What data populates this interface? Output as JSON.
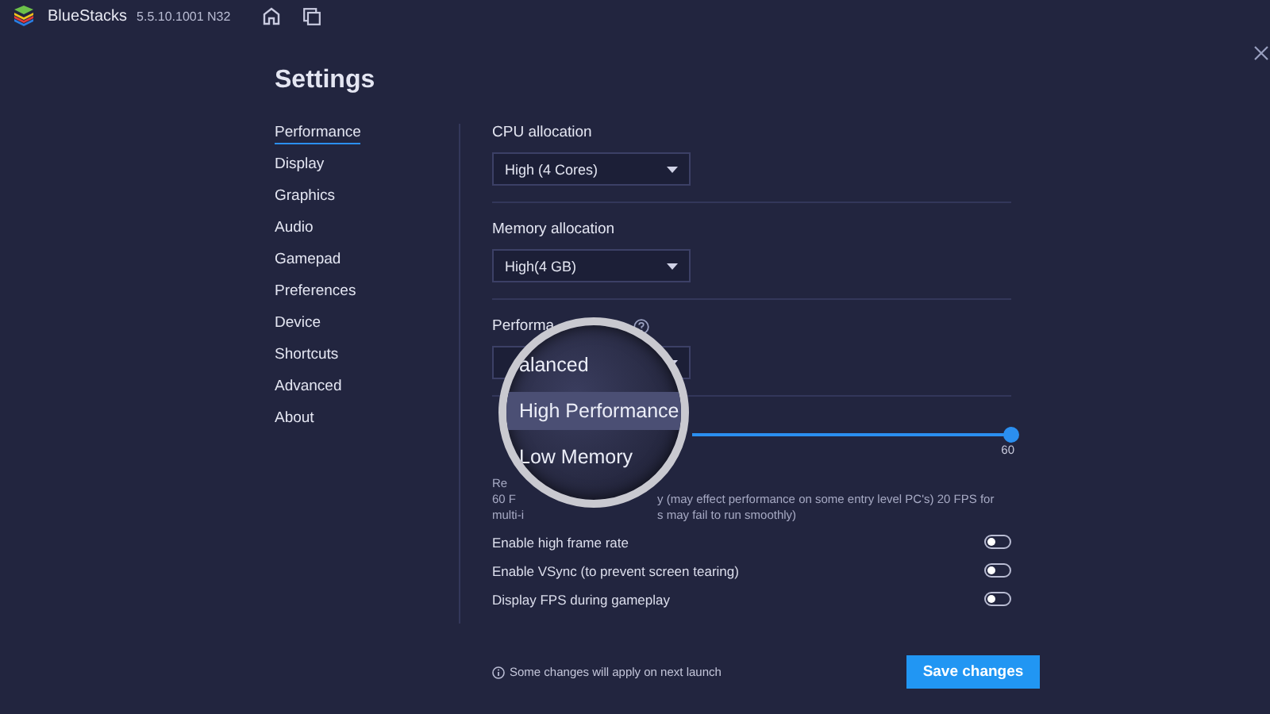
{
  "app": {
    "name": "BlueStacks",
    "version": "5.5.10.1001 N32"
  },
  "title": "Settings",
  "sidebar": {
    "items": [
      {
        "label": "Performance",
        "selected": true
      },
      {
        "label": "Display",
        "selected": false
      },
      {
        "label": "Graphics",
        "selected": false
      },
      {
        "label": "Audio",
        "selected": false
      },
      {
        "label": "Gamepad",
        "selected": false
      },
      {
        "label": "Preferences",
        "selected": false
      },
      {
        "label": "Device",
        "selected": false
      },
      {
        "label": "Shortcuts",
        "selected": false
      },
      {
        "label": "Advanced",
        "selected": false
      },
      {
        "label": "About",
        "selected": false
      }
    ]
  },
  "cpu": {
    "label": "CPU allocation",
    "value": "High (4 Cores)"
  },
  "memory": {
    "label": "Memory allocation",
    "value": "High(4 GB)"
  },
  "mode": {
    "label": "Performa"
  },
  "magnifier": {
    "options": [
      {
        "label": "alanced",
        "selected": false
      },
      {
        "label": "High Performance",
        "selected": true
      },
      {
        "label": "Low Memory",
        "selected": false
      }
    ]
  },
  "fps": {
    "level": 1,
    "reading": "60",
    "note_lines": [
      {
        "left": "Re"
      },
      {
        "left": "60 F",
        "right": "y (may effect performance on some entry level PC's) 20 FPS for"
      },
      {
        "left": "multi-i",
        "right": "s may fail to run smoothly)"
      }
    ]
  },
  "toggles": [
    {
      "label": "Enable high frame rate",
      "on": false
    },
    {
      "label": "Enable VSync (to prevent screen tearing)",
      "on": false
    },
    {
      "label": "Display FPS during gameplay",
      "on": false
    }
  ],
  "footer": {
    "note": "Some changes will apply on next launch",
    "save": "Save changes"
  }
}
